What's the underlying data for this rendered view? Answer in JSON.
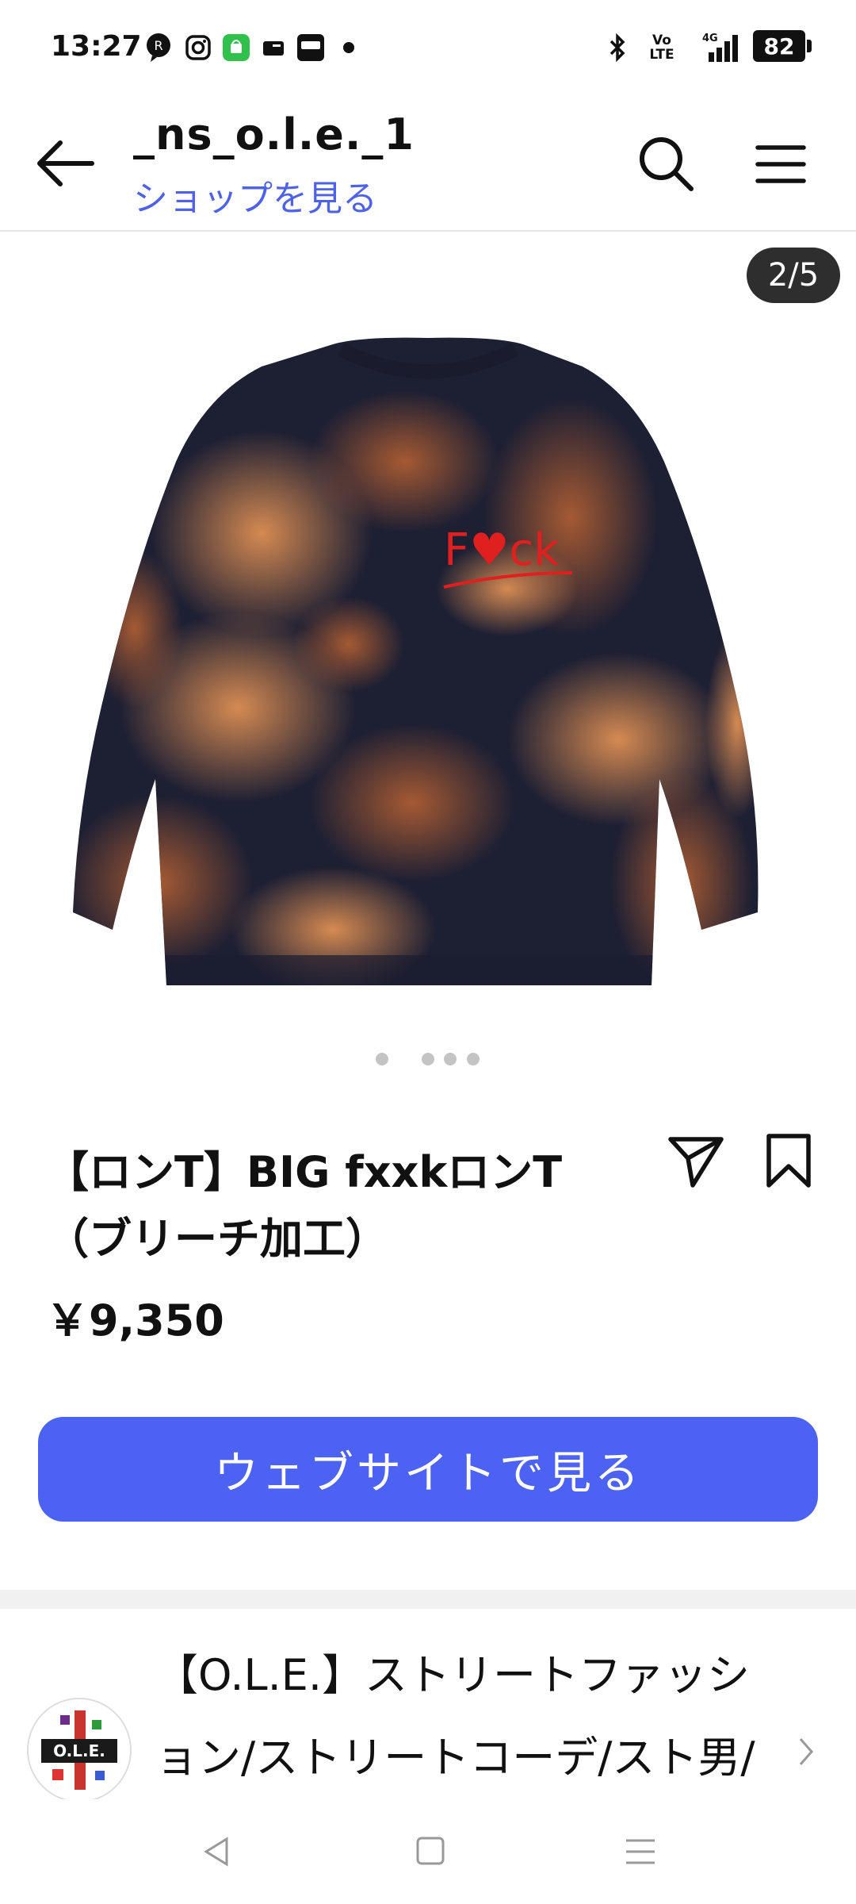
{
  "status_bar": {
    "time": "13:27",
    "battery": "82",
    "network": "4G",
    "volte": "Vo LTE"
  },
  "header": {
    "shop_name": "_ns_o.l.e._1",
    "shop_link": "ショップを見る"
  },
  "gallery": {
    "counter": "2/5",
    "print_text": "F♥ck"
  },
  "product": {
    "title_line1": "【ロンT】BIG fxxkロンT",
    "title_line2": "（ブリーチ加工）",
    "price": "￥9,350"
  },
  "cta": {
    "label": "ウェブサイトで見る"
  },
  "store": {
    "line1": "【O.L.E.】ストリートファッシ",
    "line2": "ョン/ストリートコーデ/スト男/",
    "logo_text": "O.L.E."
  },
  "colors": {
    "accent": "#4c62f2",
    "link": "#4e62e6",
    "shirt_dark": "#1d1f33",
    "shirt_bleach": "#b56a3a"
  }
}
